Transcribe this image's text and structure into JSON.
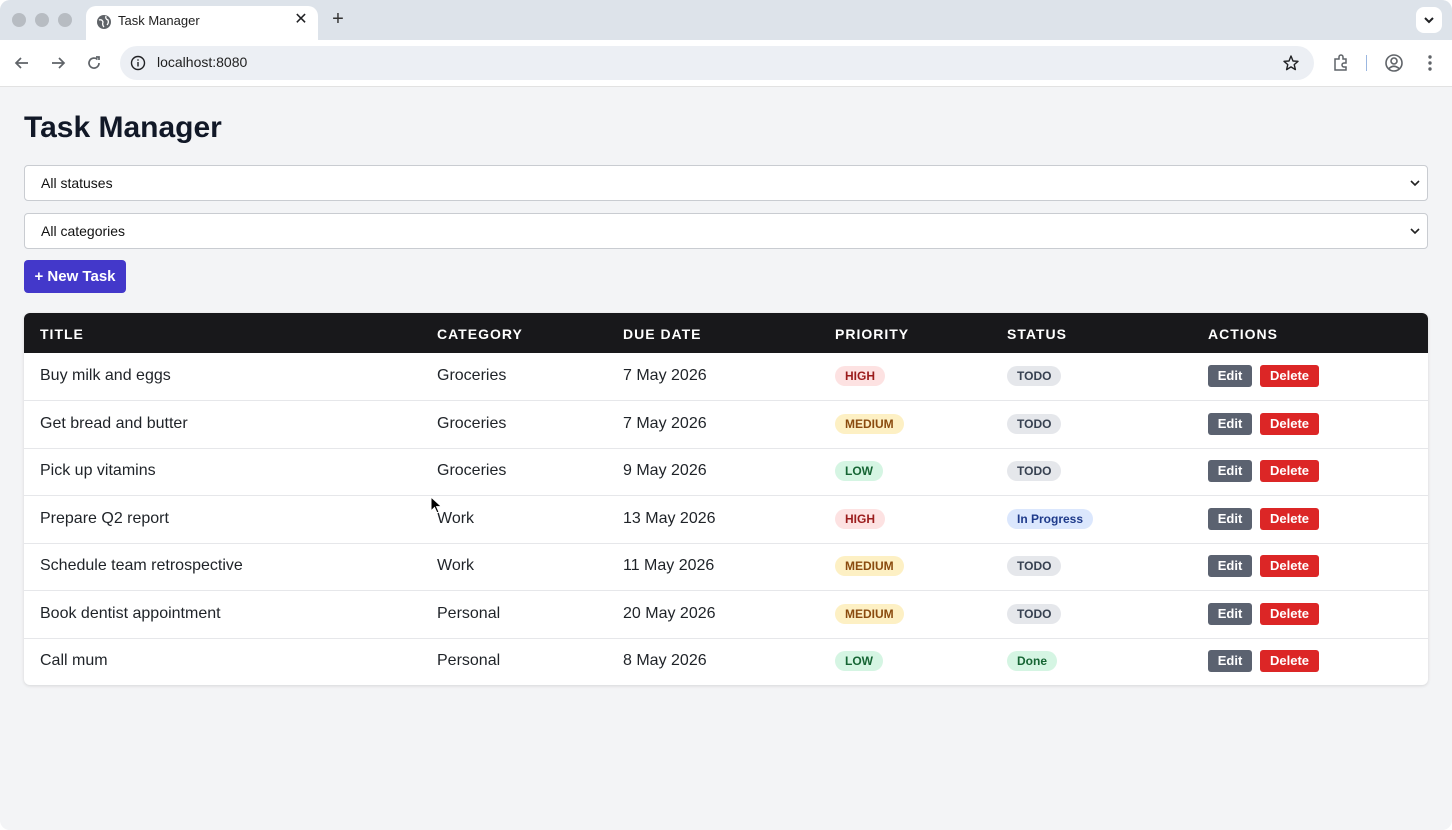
{
  "browser": {
    "tab_title": "Task Manager",
    "tab_close": "✕",
    "new_tab": "+",
    "url": "localhost:8080"
  },
  "page": {
    "title": "Task Manager",
    "status_filter": "All statuses",
    "category_filter": "All categories",
    "new_task_label": "+ New Task"
  },
  "table": {
    "headers": [
      "TITLE",
      "CATEGORY",
      "DUE DATE",
      "PRIORITY",
      "STATUS",
      "ACTIONS"
    ],
    "edit_label": "Edit",
    "delete_label": "Delete",
    "rows": [
      {
        "title": "Buy milk and eggs",
        "category": "Groceries",
        "due": "7 May 2026",
        "priority": "HIGH",
        "status": "TODO"
      },
      {
        "title": "Get bread and butter",
        "category": "Groceries",
        "due": "7 May 2026",
        "priority": "MEDIUM",
        "status": "TODO"
      },
      {
        "title": "Pick up vitamins",
        "category": "Groceries",
        "due": "9 May 2026",
        "priority": "LOW",
        "status": "TODO"
      },
      {
        "title": "Prepare Q2 report",
        "category": "Work",
        "due": "13 May 2026",
        "priority": "HIGH",
        "status": "In Progress"
      },
      {
        "title": "Schedule team retrospective",
        "category": "Work",
        "due": "11 May 2026",
        "priority": "MEDIUM",
        "status": "TODO"
      },
      {
        "title": "Book dentist appointment",
        "category": "Personal",
        "due": "20 May 2026",
        "priority": "MEDIUM",
        "status": "TODO"
      },
      {
        "title": "Call mum",
        "category": "Personal",
        "due": "8 May 2026",
        "priority": "LOW",
        "status": "Done"
      }
    ]
  },
  "colors": {
    "accent": "#4338ca",
    "header_bg": "#18181b",
    "delete": "#dc2626",
    "edit": "#5b6270",
    "priority": {
      "HIGH": {
        "bg": "#fde2e2",
        "fg": "#9b1c1c"
      },
      "MEDIUM": {
        "bg": "#fdf0c4",
        "fg": "#8a4b0f"
      },
      "LOW": {
        "bg": "#d5f5e3",
        "fg": "#166534"
      }
    },
    "status": {
      "TODO": {
        "bg": "#e5e7eb",
        "fg": "#374151"
      },
      "In Progress": {
        "bg": "#dbe7fd",
        "fg": "#1e3a8a"
      },
      "Done": {
        "bg": "#d5f5e3",
        "fg": "#166534"
      }
    }
  },
  "icons": [
    "globe-icon",
    "close-icon",
    "plus-icon",
    "chevron-down-icon",
    "back-arrow-icon",
    "forward-arrow-icon",
    "reload-icon",
    "info-icon",
    "star-icon",
    "extensions-icon",
    "profile-icon",
    "more-vert-icon",
    "mouse-cursor-icon"
  ]
}
